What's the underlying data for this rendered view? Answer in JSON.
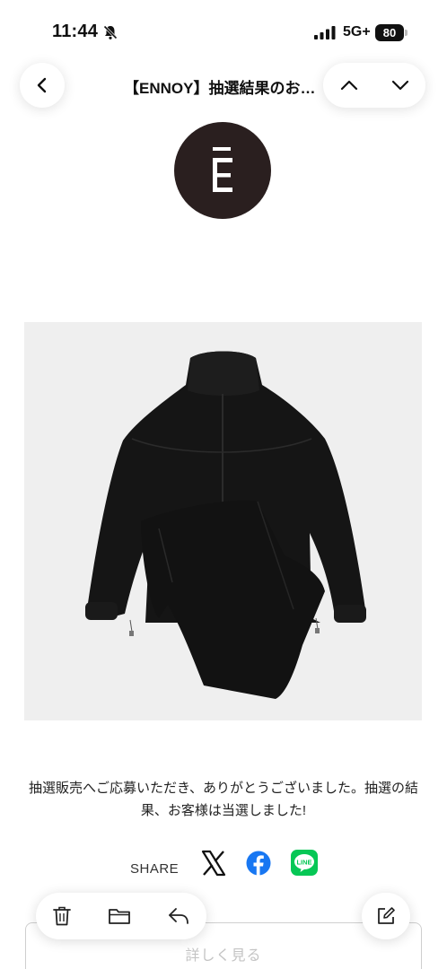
{
  "status_bar": {
    "time": "11:44",
    "network": "5G+",
    "battery": "80",
    "icons": [
      "bell-slash-icon",
      "signal-icon"
    ]
  },
  "header": {
    "title": "【ENNOY】抽選結果のお…",
    "back_icon": "chevron-left-icon",
    "prev_icon": "chevron-up-icon",
    "next_icon": "chevron-down-icon"
  },
  "email": {
    "logo_letter": "Ē",
    "image": "black-jacket-and-pants-photo",
    "message": "抽選販売へご応募いただき、ありがとうございました。抽選の結果、お客様は当選しました!",
    "share_label": "SHARE",
    "share_icons": [
      "x-icon",
      "facebook-icon",
      "line-icon"
    ],
    "line_text": "LINE",
    "details_button": "詳しく見る"
  },
  "toolbar": {
    "icons": [
      "trash-icon",
      "folder-icon",
      "reply-icon",
      "compose-icon"
    ]
  },
  "colors": {
    "logo_bg": "#2a1f1f",
    "facebook": "#1877f2",
    "line": "#06c755"
  }
}
